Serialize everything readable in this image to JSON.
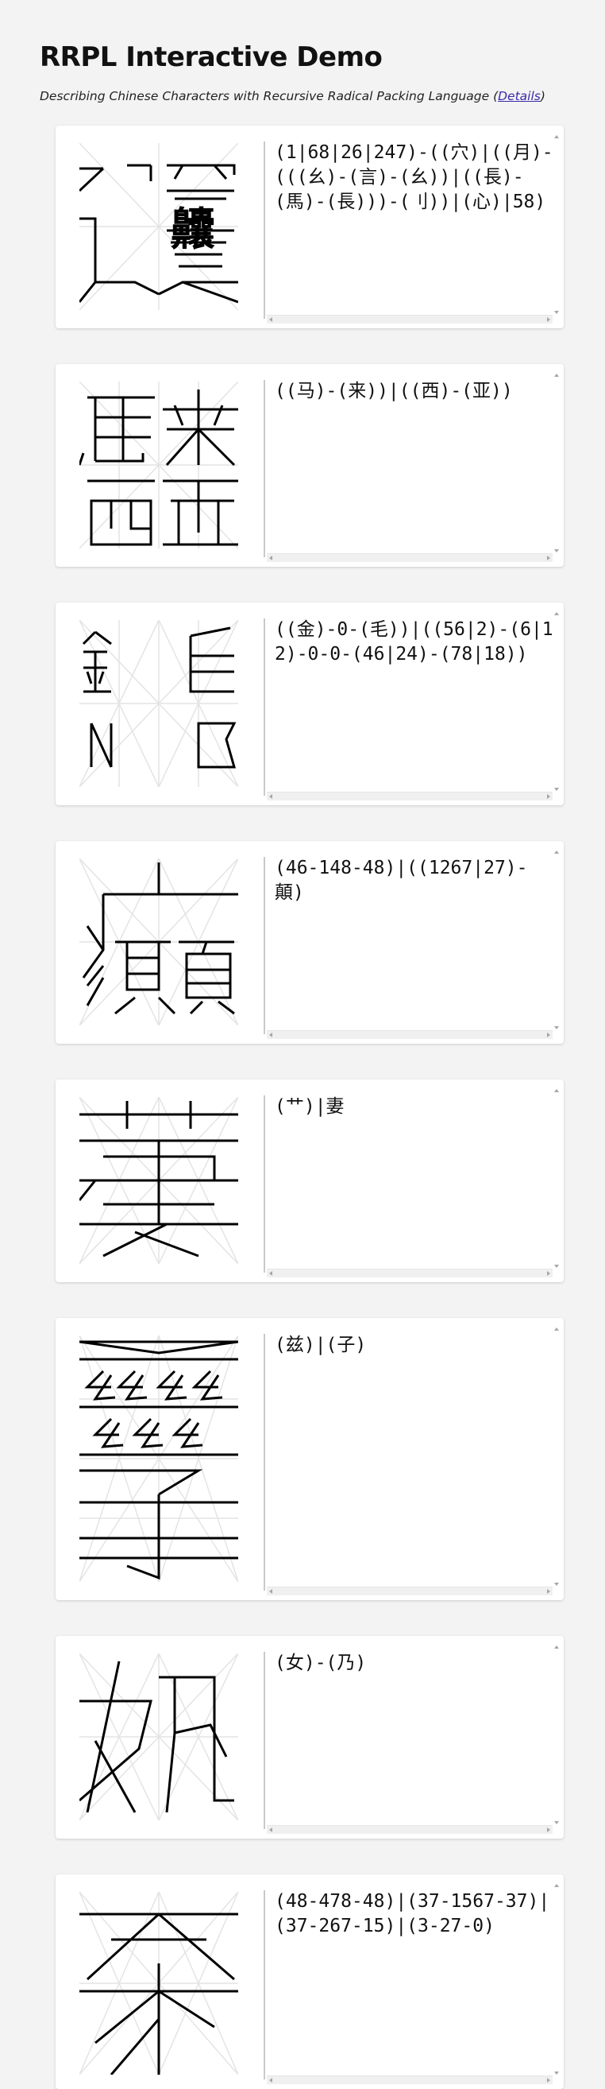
{
  "page": {
    "title": "RRPL Interactive Demo",
    "subtitle": "Describing Chinese Characters with Recursive Radical Packing Language",
    "details_open": "(",
    "details_link": "Details",
    "details_close": ")"
  },
  "cards": [
    {
      "code": "(1|68|26|247)-((穴)|((月)-(((幺)-(言)-(幺))|((長)-(馬)-(長)))-(刂))|(心)|58)"
    },
    {
      "code": "((马)-(来))|((西)-(亚))"
    },
    {
      "code": "((金)-0-(毛))|((56|2)-(6|12)-0-0-(46|24)-(78|18))"
    },
    {
      "code": "(46-148-48)|((1267|27)-顛)"
    },
    {
      "code": "(艹)|妻"
    },
    {
      "code": "(兹)|(子)"
    },
    {
      "code": "(女)-(乃)"
    },
    {
      "code": "(48-478-48)|(37-1567-37)|(37-267-15)|(3-27-0)"
    }
  ],
  "colors": {
    "background": "#f3f3f3",
    "card": "#ffffff",
    "link": "#3a2aa8",
    "stroke": "#000000",
    "grid": "#e4e4e4"
  }
}
